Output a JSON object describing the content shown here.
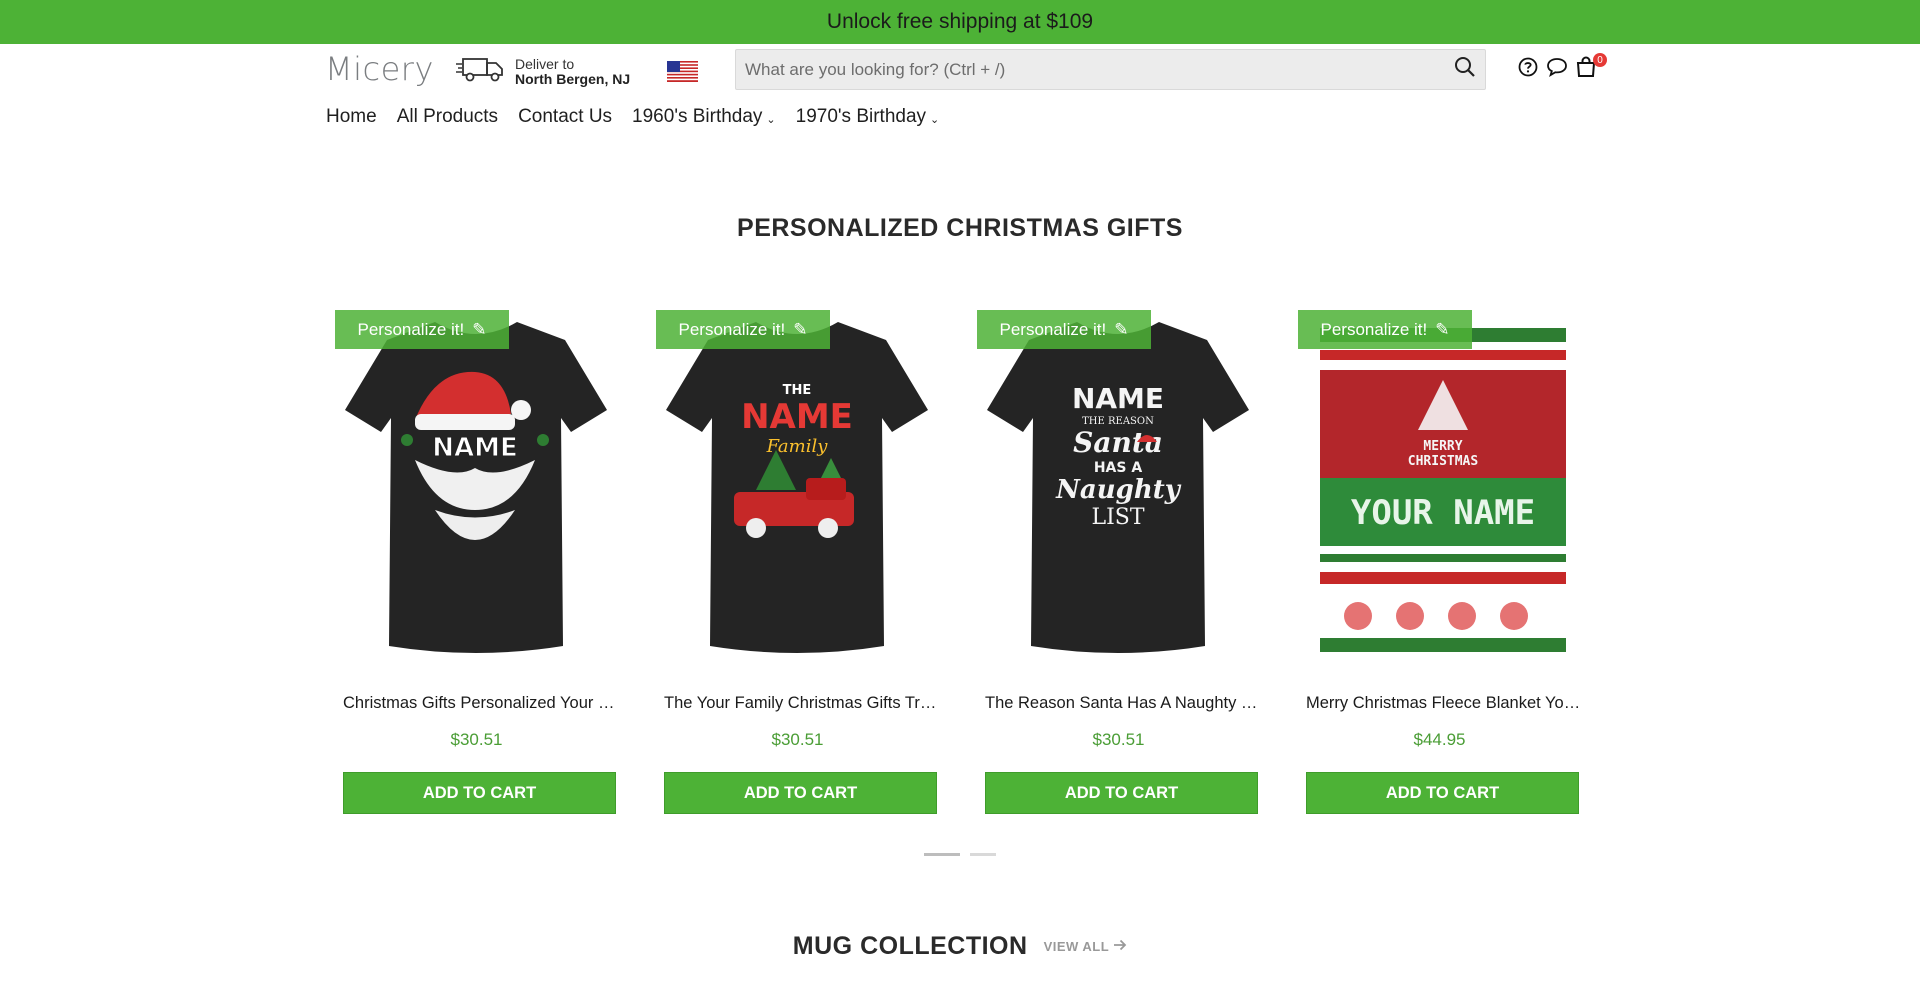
{
  "promo": {
    "text": "Unlock free shipping at $109"
  },
  "header": {
    "logo": "Micery",
    "deliver_label": "Deliver to",
    "deliver_location": "North Bergen, NJ",
    "search_placeholder": "What are you looking for? (Ctrl + /)",
    "cart_count": "0"
  },
  "nav": {
    "items": [
      {
        "label": "Home"
      },
      {
        "label": "All Products"
      },
      {
        "label": "Contact Us"
      },
      {
        "label": "1960's Birthday"
      },
      {
        "label": "1970's Birthday"
      }
    ]
  },
  "section": {
    "title": "PERSONALIZED CHRISTMAS GIFTS"
  },
  "products": [
    {
      "badge": "Personalize it!",
      "title": "Christmas Gifts Personalized Your Name Santa Hat Beard T-Shirt",
      "price": "$30.51",
      "cta": "ADD TO CART",
      "art_text": "NAME"
    },
    {
      "badge": "Personalize it!",
      "title": "The Your Family Christmas Gifts Truck T-Shirt",
      "price": "$30.51",
      "cta": "ADD TO CART",
      "art_text": "NAME"
    },
    {
      "badge": "Personalize it!",
      "title": "The Reason Santa Has A Naughty List T-Shirt",
      "price": "$30.51",
      "cta": "ADD TO CART",
      "art_text": "NAME"
    },
    {
      "badge": "Personalize it!",
      "title": "Merry Christmas Fleece Blanket Your Name",
      "price": "$44.95",
      "cta": "ADD TO CART",
      "art_text": "YOUR NAME"
    }
  ],
  "artwork": {
    "shirt2_lines": [
      "THE",
      "NAME",
      "Family"
    ],
    "shirt3_lines": [
      "THE REASON",
      "Santa",
      "HAS A",
      "Naughty",
      "LIST"
    ],
    "blanket_lines": [
      "MERRY",
      "CHRISTMAS"
    ]
  },
  "mug": {
    "title": "MUG COLLECTION",
    "view_all": "VIEW ALL"
  },
  "colors": {
    "brand_green": "#4db236",
    "price_green": "#4a9d35",
    "badge_red": "#e53935"
  }
}
